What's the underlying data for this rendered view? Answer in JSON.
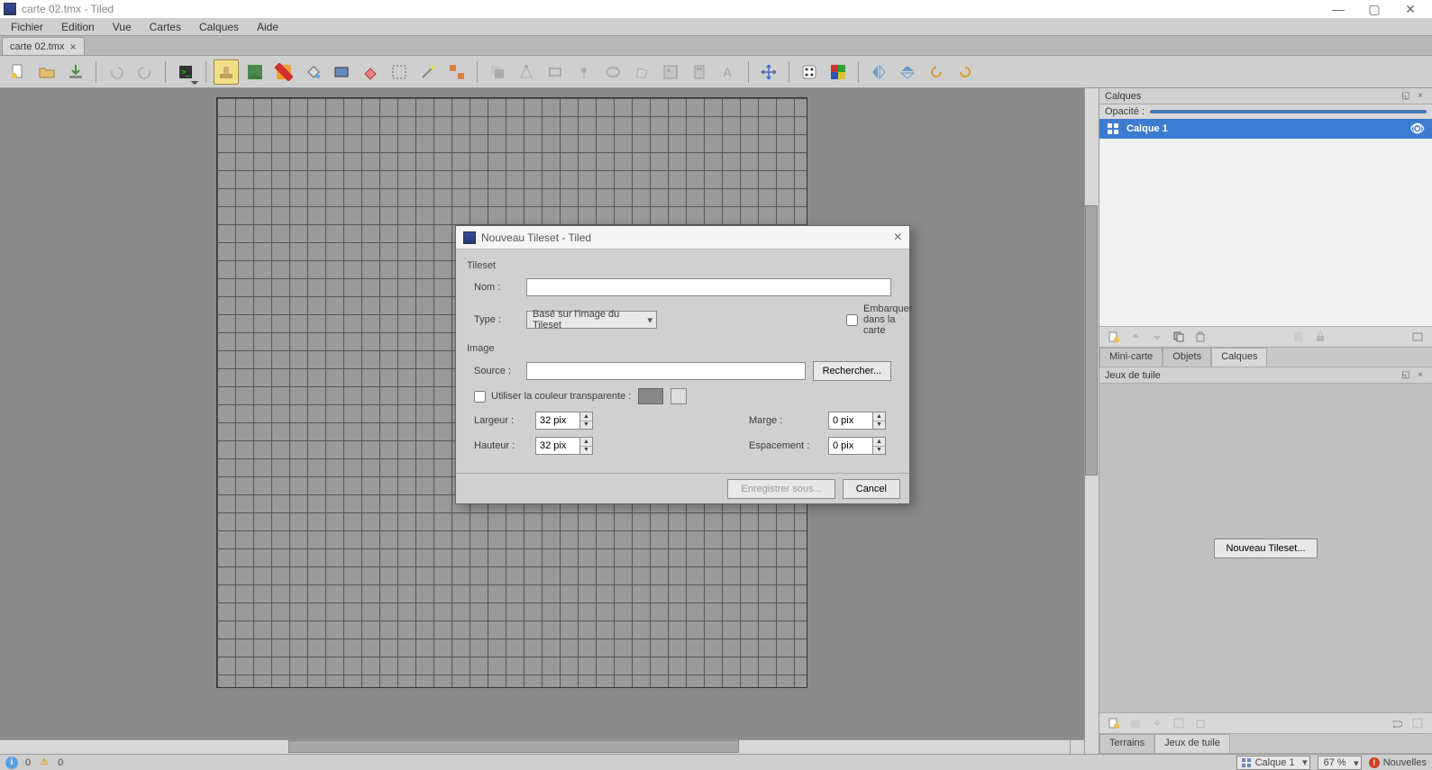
{
  "window": {
    "title": "carte 02.tmx - Tiled"
  },
  "menubar": {
    "items": [
      "Fichier",
      "Edition",
      "Vue",
      "Cartes",
      "Calques",
      "Aide"
    ]
  },
  "tab": {
    "name": "carte 02.tmx"
  },
  "layers_panel": {
    "title": "Calques",
    "opacity_label": "Opacité :",
    "layers": [
      {
        "name": "Calque 1",
        "visible": true
      }
    ]
  },
  "panel_tabs": {
    "minimap": "Mini-carte",
    "objects": "Objets",
    "layers": "Calques"
  },
  "tilesets_panel": {
    "title": "Jeux de tuile",
    "new_button": "Nouveau Tileset..."
  },
  "bottom_tabs": {
    "terrains": "Terrains",
    "tilesets": "Jeux de tuile"
  },
  "statusbar": {
    "errors": "0",
    "warnings": "0",
    "layer_combo": "Calque 1",
    "zoom": "67 %",
    "news": "Nouvelles"
  },
  "dialog": {
    "title": "Nouveau Tileset - Tiled",
    "tileset_group": "Tileset",
    "name_label": "Nom :",
    "name_value": "",
    "type_label": "Type :",
    "type_value": "Basé sur l'image du Tileset",
    "embed_label": "Embarquer dans la carte",
    "image_group": "Image",
    "source_label": "Source :",
    "source_value": "",
    "browse_button": "Rechercher...",
    "transparent_label": "Utiliser la couleur transparente :",
    "width_label": "Largeur :",
    "width_value": "32 pix",
    "height_label": "Hauteur :",
    "height_value": "32 pix",
    "margin_label": "Marge :",
    "margin_value": "0 pix",
    "spacing_label": "Espacement :",
    "spacing_value": "0 pix",
    "save_as": "Enregistrer sous...",
    "cancel": "Cancel"
  }
}
